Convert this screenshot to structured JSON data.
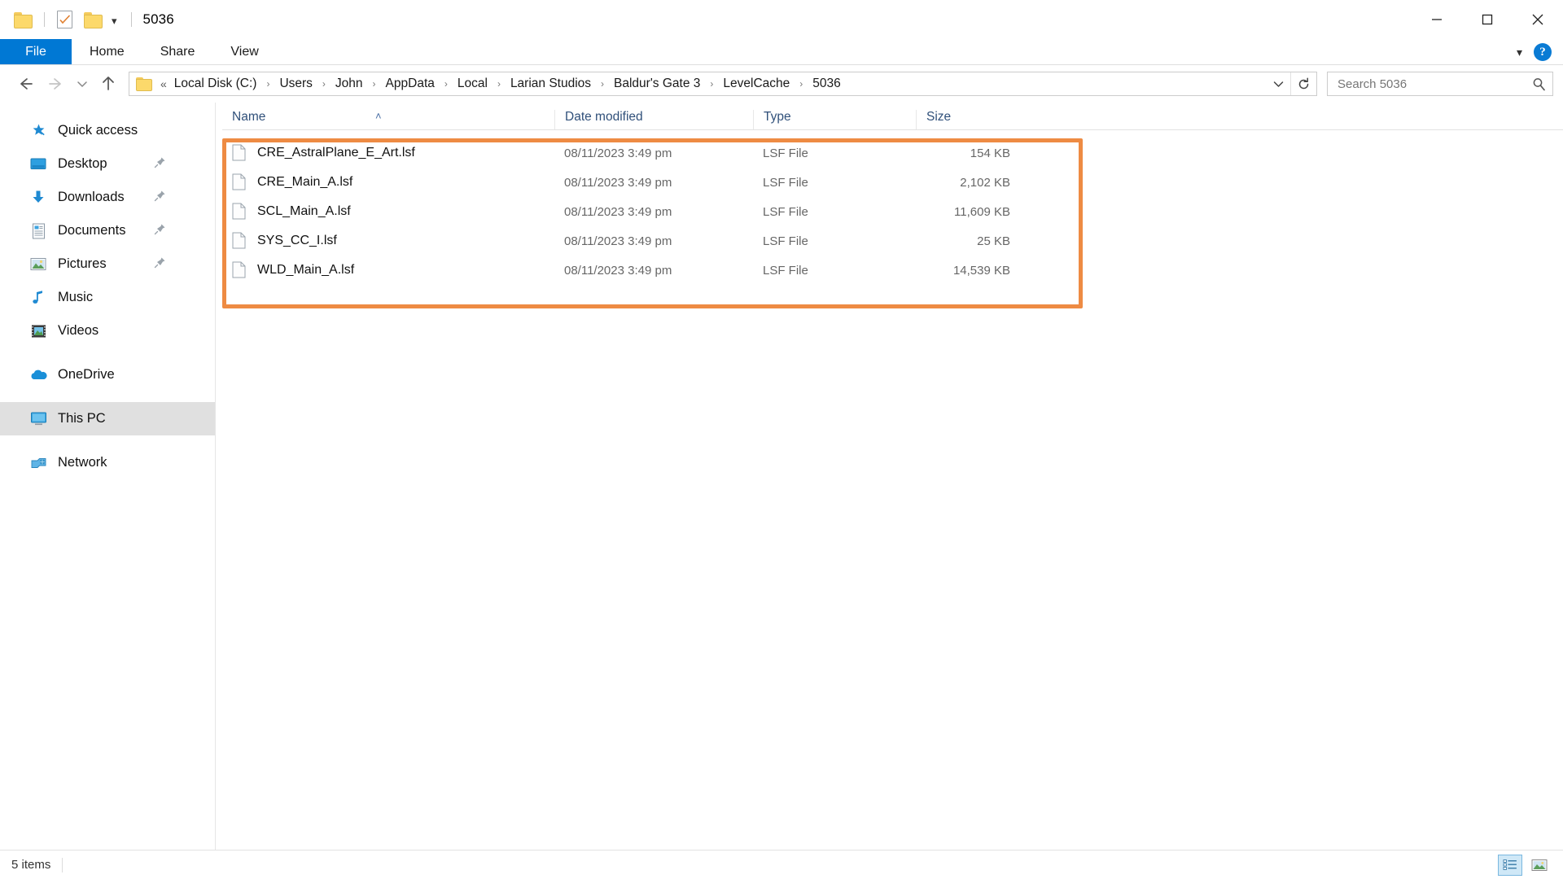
{
  "window": {
    "title": "5036",
    "quick_access_icons": [
      "folder-icon",
      "properties-icon",
      "new-folder-icon",
      "customize-caret-icon"
    ],
    "controls": {
      "minimize": "minimize-icon",
      "maximize": "maximize-icon",
      "close": "close-icon"
    }
  },
  "ribbon": {
    "tabs": [
      {
        "label": "File",
        "active": true
      },
      {
        "label": "Home",
        "active": false
      },
      {
        "label": "Share",
        "active": false
      },
      {
        "label": "View",
        "active": false
      }
    ],
    "collapse_icon": "chevron-down-icon",
    "help_label": "?"
  },
  "address": {
    "back_icon": "back-arrow-icon",
    "forward_icon": "forward-arrow-icon",
    "recent_icon": "chevron-down-icon",
    "up_icon": "up-arrow-icon",
    "overflow": "«",
    "crumbs": [
      "Local Disk (C:)",
      "Users",
      "John",
      "AppData",
      "Local",
      "Larian Studios",
      "Baldur's Gate 3",
      "LevelCache",
      "5036"
    ],
    "separator": "›",
    "dropdown_icon": "chevron-down-icon",
    "refresh_icon": "refresh-icon"
  },
  "search": {
    "placeholder": "Search 5036",
    "icon": "search-icon"
  },
  "sidebar": {
    "items": [
      {
        "label": "Quick access",
        "icon": "star-pin-icon",
        "pinned": false,
        "selected": false,
        "gap_after": false
      },
      {
        "label": "Desktop",
        "icon": "desktop-icon",
        "pinned": true,
        "selected": false,
        "gap_after": false
      },
      {
        "label": "Downloads",
        "icon": "download-icon",
        "pinned": true,
        "selected": false,
        "gap_after": false
      },
      {
        "label": "Documents",
        "icon": "document-icon",
        "pinned": true,
        "selected": false,
        "gap_after": false
      },
      {
        "label": "Pictures",
        "icon": "pictures-icon",
        "pinned": true,
        "selected": false,
        "gap_after": false
      },
      {
        "label": "Music",
        "icon": "music-note-icon",
        "pinned": false,
        "selected": false,
        "gap_after": false
      },
      {
        "label": "Videos",
        "icon": "video-icon",
        "pinned": false,
        "selected": false,
        "gap_after": true
      },
      {
        "label": "OneDrive",
        "icon": "cloud-icon",
        "pinned": false,
        "selected": false,
        "gap_after": true
      },
      {
        "label": "This PC",
        "icon": "this-pc-icon",
        "pinned": false,
        "selected": true,
        "gap_after": true
      },
      {
        "label": "Network",
        "icon": "network-icon",
        "pinned": false,
        "selected": false,
        "gap_after": false
      }
    ]
  },
  "filelist": {
    "columns": [
      {
        "label": "Name",
        "sorted": "asc"
      },
      {
        "label": "Date modified",
        "sorted": ""
      },
      {
        "label": "Type",
        "sorted": ""
      },
      {
        "label": "Size",
        "sorted": ""
      }
    ],
    "sort_caret": "˄",
    "rows": [
      {
        "name": "CRE_AstralPlane_E_Art.lsf",
        "date": "08/11/2023 3:49 pm",
        "type": "LSF File",
        "size": "154 KB"
      },
      {
        "name": "CRE_Main_A.lsf",
        "date": "08/11/2023 3:49 pm",
        "type": "LSF File",
        "size": "2,102 KB"
      },
      {
        "name": "SCL_Main_A.lsf",
        "date": "08/11/2023 3:49 pm",
        "type": "LSF File",
        "size": "11,609 KB"
      },
      {
        "name": "SYS_CC_I.lsf",
        "date": "08/11/2023 3:49 pm",
        "type": "LSF File",
        "size": "25 KB"
      },
      {
        "name": "WLD_Main_A.lsf",
        "date": "08/11/2023 3:49 pm",
        "type": "LSF File",
        "size": "14,539 KB"
      }
    ],
    "highlight_color": "#ee8b43"
  },
  "status": {
    "item_count": "5 items",
    "views": [
      {
        "name": "details-view",
        "active": true
      },
      {
        "name": "large-icons-view",
        "active": false
      }
    ]
  }
}
